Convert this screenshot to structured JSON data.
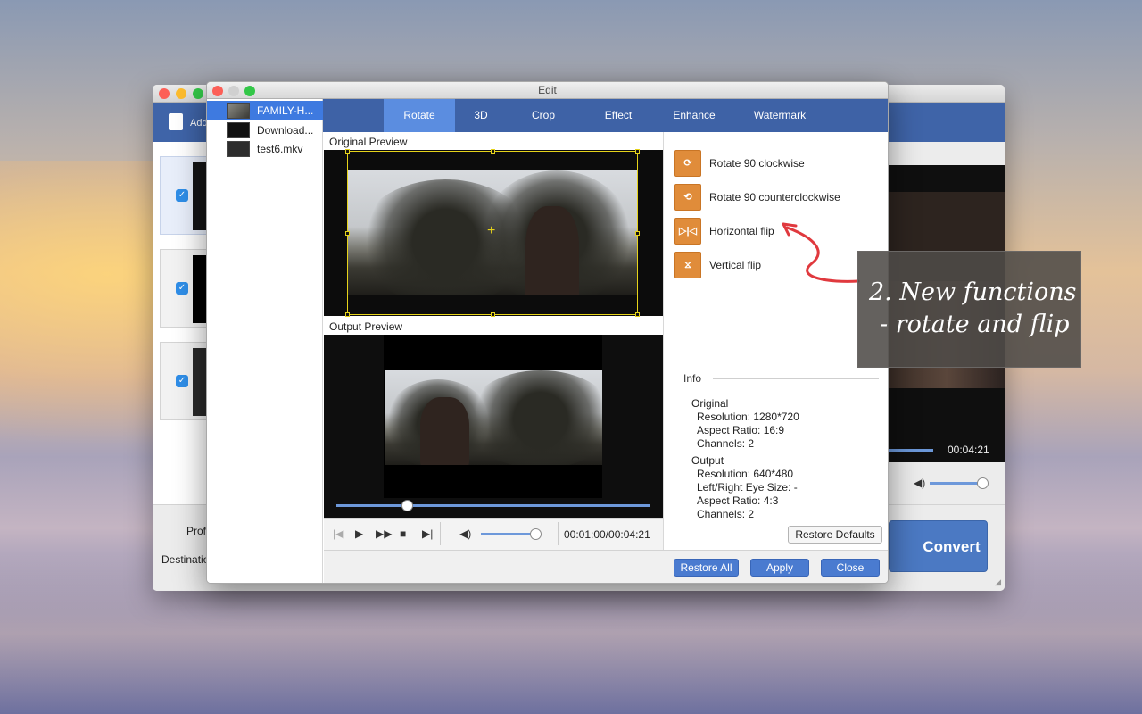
{
  "main_window": {
    "toolbar_add_label": "Add",
    "profile_label": "Profile",
    "destination_label": "Destination",
    "time_code": "00:04:21",
    "convert_label": "Convert"
  },
  "edit_window": {
    "title": "Edit",
    "files": [
      {
        "name": "FAMILY-H..."
      },
      {
        "name": "Download..."
      },
      {
        "name": "test6.mkv"
      }
    ],
    "tabs": [
      {
        "label": "Rotate"
      },
      {
        "label": "3D"
      },
      {
        "label": "Crop"
      },
      {
        "label": "Effect"
      },
      {
        "label": "Enhance"
      },
      {
        "label": "Watermark"
      }
    ],
    "original_preview_label": "Original Preview",
    "output_preview_label": "Output Preview",
    "playback_time": "00:01:00/00:04:21",
    "rotate_options": [
      {
        "label": "Rotate 90 clockwise",
        "icon": "rotate-cw-icon"
      },
      {
        "label": "Rotate 90 counterclockwise",
        "icon": "rotate-ccw-icon"
      },
      {
        "label": "Horizontal flip",
        "icon": "flip-horizontal-icon"
      },
      {
        "label": "Vertical flip",
        "icon": "flip-vertical-icon"
      }
    ],
    "info": {
      "title": "Info",
      "original_heading": "Original",
      "original_resolution": "Resolution: 1280*720",
      "original_aspect": "Aspect Ratio: 16:9",
      "original_channels": "Channels: 2",
      "output_heading": "Output",
      "output_resolution": "Resolution: 640*480",
      "output_eye_size": "Left/Right Eye Size: -",
      "output_aspect": "Aspect Ratio: 4:3",
      "output_channels": "Channels: 2"
    },
    "buttons": {
      "restore_defaults": "Restore Defaults",
      "restore_all": "Restore All",
      "apply": "Apply",
      "close": "Close"
    }
  },
  "callout": {
    "line1": "2. New functions",
    "line2": "- rotate and flip"
  },
  "colors": {
    "toolbar_blue": "#3e62a6",
    "tab_active": "#5b8de0",
    "accent_orange": "#e08c3a",
    "annotation_red": "#e0393e"
  }
}
